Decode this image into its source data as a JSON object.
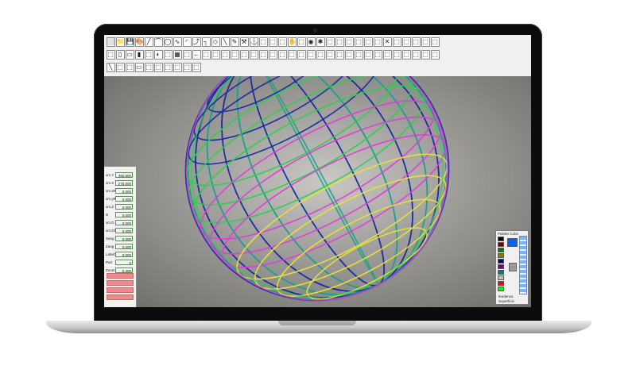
{
  "window": {
    "title": ""
  },
  "toolbar": {
    "row1": [
      "⬜",
      "📁",
      "💾",
      "🎨",
      "╱",
      "⌒",
      "◯",
      "∿",
      "◜",
      "⤴",
      "┐",
      "◇",
      "╲",
      "✎",
      "⚒",
      "⚓",
      "⬚",
      "⬚",
      "⬚",
      "✋",
      "⬚",
      "◉",
      "✱",
      "⬚",
      "⬚",
      "⬚",
      "⬚",
      "⬚",
      "⬚",
      "✕",
      "⬚",
      "⬚",
      "⬚",
      "⬚",
      "⬚"
    ],
    "row2": [
      "⬚",
      "▯",
      "▭",
      "▮",
      "⬚",
      "◐",
      "⬚",
      "▦",
      "⬚",
      "←",
      "⬚",
      "⬚",
      "⬚",
      "⬚",
      "⬚",
      "⬚",
      "⬚",
      "⬚",
      "⬚",
      "⬚",
      "⬚",
      "⬚",
      "⬚",
      "⬚",
      "⬚",
      "⬚",
      "⬚",
      "⬚",
      "⬚",
      "⬚",
      "⬚",
      "⬚",
      "⬚",
      "⬚",
      "⬚"
    ],
    "row3": [
      "╲",
      "⬚",
      "⬚",
      "▭",
      "⬚",
      "⬚",
      "⬚",
      "⬚",
      "⬚",
      "⬚"
    ]
  },
  "coords": {
    "rows": [
      {
        "label": "xm.Y",
        "value": "492.500"
      },
      {
        "label": "xm.X",
        "value": "275.000"
      },
      {
        "label": "xm.xR",
        "value": "0.000"
      },
      {
        "label": "xm.yR",
        "value": "0.000"
      },
      {
        "label": "xm.Z",
        "value": "0.000"
      },
      {
        "label": "D",
        "value": "0.000"
      },
      {
        "label": "xm.D",
        "value": "0.000"
      },
      {
        "label": "xm.D1",
        "value": "0.000"
      },
      {
        "label": "Sang",
        "value": "0.000"
      },
      {
        "label": "Zang",
        "value": "0.000"
      },
      {
        "label": "Label3",
        "value": "0.000"
      },
      {
        "label": "Part",
        "value": "0"
      },
      {
        "label": "Zoom",
        "value": "0.400"
      }
    ]
  },
  "palette": {
    "title": "Palette Color",
    "check1": "Evidenza",
    "check2": "Superficie",
    "colors": [
      "#000000",
      "#800000",
      "#008000",
      "#808000",
      "#000080",
      "#800080",
      "#008080",
      "#c0c0c0",
      "#ff0000",
      "#00ff00",
      "#ffff00",
      "#0000ff",
      "#ff00ff",
      "#00ffff",
      "#ffffff",
      "#808080"
    ],
    "selected": "#0066ff"
  },
  "sphere_colors": [
    "#1a2aa0",
    "#2bd04a",
    "#e23ad8",
    "#e8e23a",
    "#17a08a",
    "#5a2a9a"
  ]
}
